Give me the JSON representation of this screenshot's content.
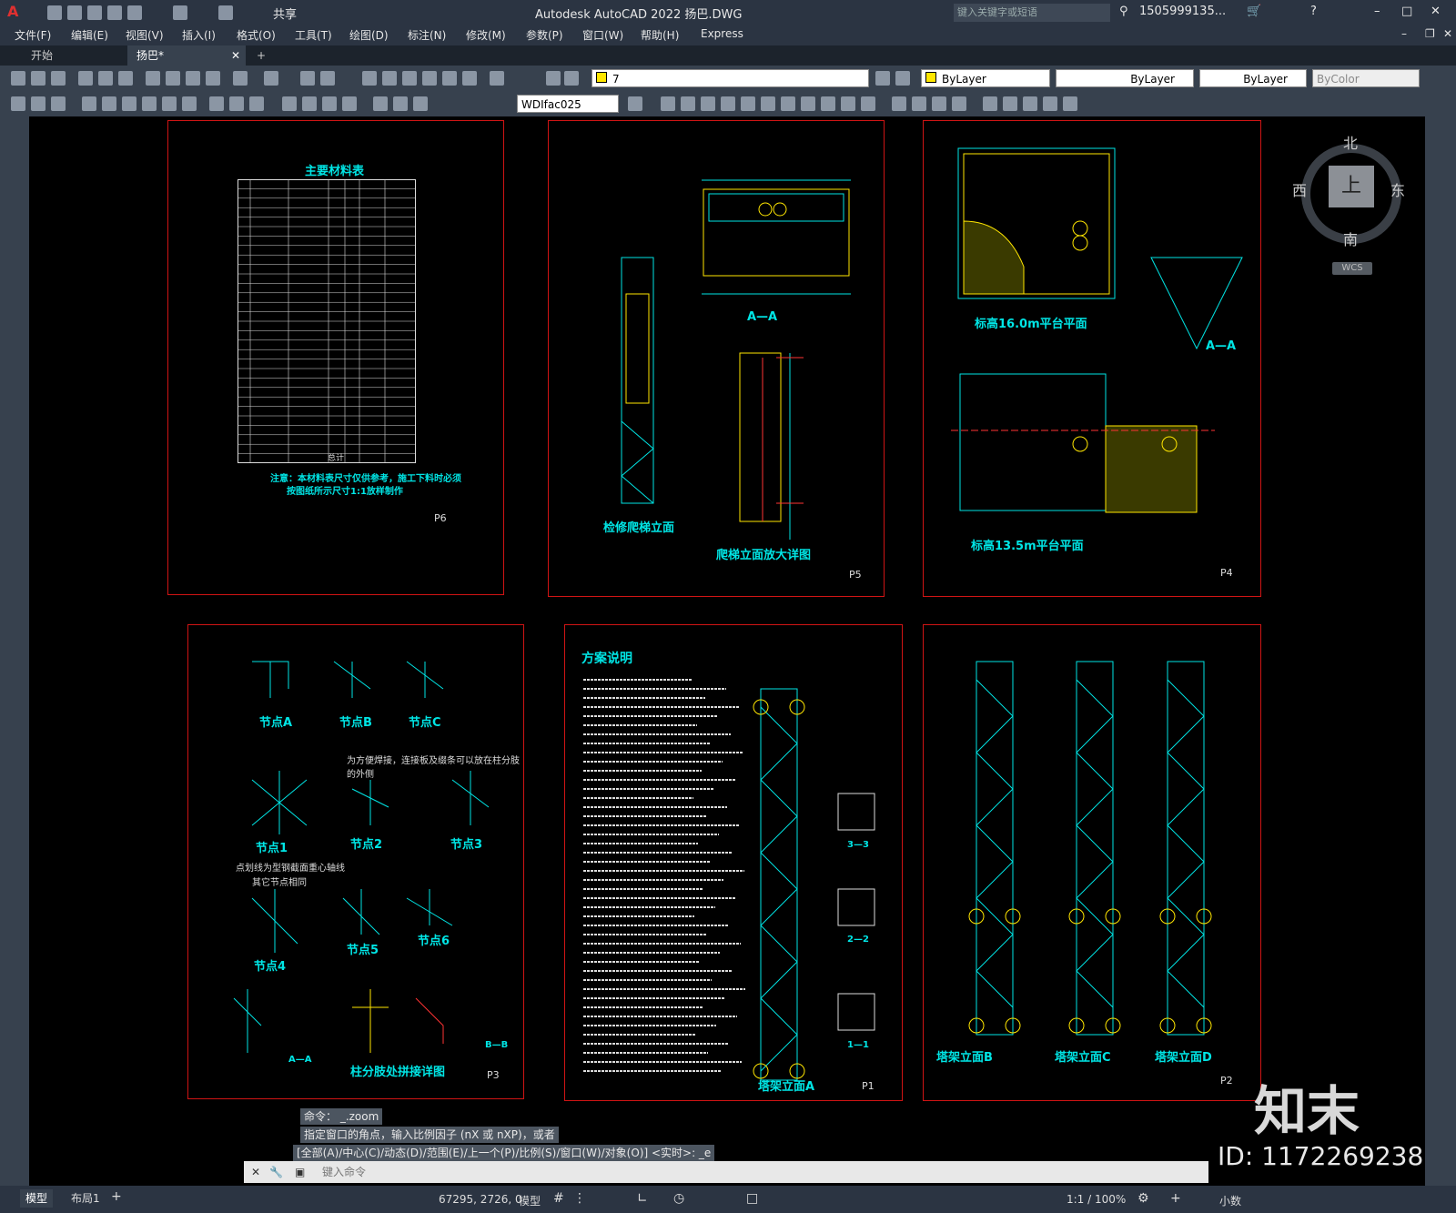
{
  "app": {
    "title": "Autodesk AutoCAD 2022    扬巴.DWG",
    "logo": "A",
    "share": "共享"
  },
  "search": {
    "placeholder": "键入关键字或短语",
    "user": "1505999135..."
  },
  "menu": [
    "文件(F)",
    "编辑(E)",
    "视图(V)",
    "插入(I)",
    "格式(O)",
    "工具(T)",
    "绘图(D)",
    "标注(N)",
    "修改(M)",
    "参数(P)",
    "窗口(W)",
    "帮助(H)",
    "Express"
  ],
  "tabs": {
    "start": "开始",
    "doc": "扬巴*"
  },
  "toolbar": {
    "layer": "7",
    "color": "ByLayer",
    "linetype": "ByLayer",
    "lineweight": "ByLayer",
    "plotstyle": "ByColor",
    "textstyle": "WDIfac025"
  },
  "viewcube": {
    "north": "北",
    "south": "南",
    "east": "东",
    "west": "西",
    "top": "上",
    "wcs": "WCS"
  },
  "sheets": {
    "p6": {
      "page": "P6",
      "title": "主要材料表",
      "note1": "注意：本材料表尺寸仅供参考，施工下料时必须",
      "note2": "按图纸所示尺寸1:1放样制作",
      "total": "总计"
    },
    "p5": {
      "page": "P5",
      "t1": "A—A",
      "t2": "检修爬梯立面",
      "t3": "爬梯立面放大详图"
    },
    "p4": {
      "page": "P4",
      "t1": "标高16.0m平台平面",
      "t2": "标高13.5m平台平面",
      "t3": "A—A"
    },
    "p3": {
      "page": "P3",
      "a": "节点A",
      "b": "节点B",
      "c": "节点C",
      "n1": "节点1",
      "n2": "节点2",
      "n3": "节点3",
      "n4": "节点4",
      "n5": "节点5",
      "n6": "节点6",
      "note1": "为方便焊接，连接板及缀条可以放在柱分肢的外侧",
      "note2": "点划线为型钢截面重心轴线",
      "note3": "其它节点相同",
      "t": "柱分肢处拼接详图",
      "aa": "A—A",
      "bb": "B—B"
    },
    "p1": {
      "page": "P1",
      "title": "方案说明",
      "tower": "塔架立面A",
      "s33": "3—3",
      "s22": "2—2",
      "s11": "1—1"
    },
    "p2": {
      "page": "P2",
      "b": "塔架立面B",
      "c": "塔架立面C",
      "d": "塔架立面D"
    }
  },
  "command": {
    "l1": "命令： _.zoom",
    "l2": "指定窗口的角点，输入比例因子 (nX 或 nXP)，或者",
    "l3": "[全部(A)/中心(C)/动态(D)/范围(E)/上一个(P)/比例(S)/窗口(W)/对象(O)] <实时>: _e",
    "input": "键入命令"
  },
  "status": {
    "model_tab": "模型",
    "layout_tab": "布局1",
    "coords": "67295, 2726, 0",
    "model": "模型",
    "scale": "1:1 / 100%",
    "units": "小数"
  },
  "watermark": {
    "brand": "知末",
    "id": "ID: 1172269238"
  },
  "colors": {
    "accent": "#00e5e5",
    "frame": "#d01414",
    "yellow": "#ffe600"
  }
}
